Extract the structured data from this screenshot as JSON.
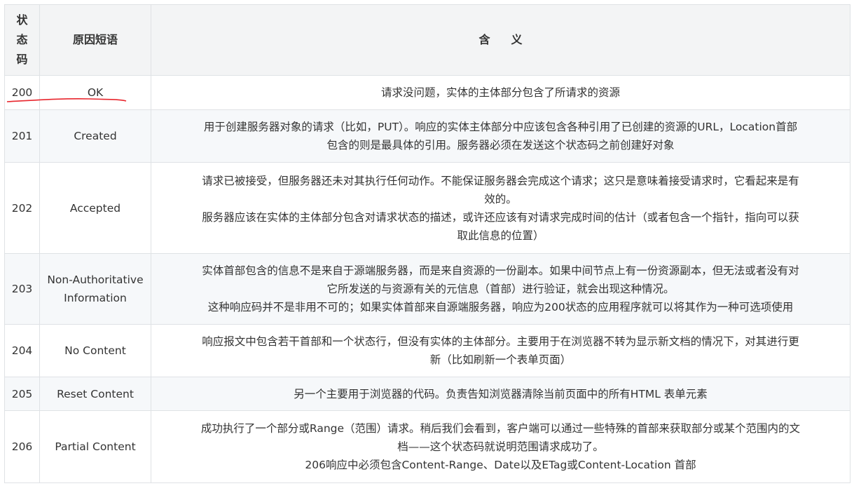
{
  "header": {
    "code_chars": [
      "状",
      "态",
      "码"
    ],
    "reason": "原因短语",
    "meaning": "含义"
  },
  "rows": [
    {
      "code": "200",
      "reason": [
        "OK"
      ],
      "meaning": [
        "请求没问题，实体的主体部分包含了所请求的资源"
      ]
    },
    {
      "code": "201",
      "reason": [
        "Created"
      ],
      "meaning": [
        "用于创建服务器对象的请求（比如，PUT）。响应的实体主体部分中应该包含各种引用了已创建的资源的URL，Location首部",
        "包含的则是最具体的引用。服务器必须在发送这个状态码之前创建好对象"
      ]
    },
    {
      "code": "202",
      "reason": [
        "Accepted"
      ],
      "meaning": [
        "请求已被接受，但服务器还未对其执行任何动作。不能保证服务器会完成这个请求；这只是意味着接受请求时，它看起来是有",
        "效的。",
        "服务器应该在实体的主体部分包含对请求状态的描述，或许还应该有对请求完成时间的估计（或者包含一个指针，指向可以获",
        "取此信息的位置）"
      ]
    },
    {
      "code": "203",
      "reason": [
        "Non-Authoritative",
        "Information"
      ],
      "meaning": [
        "实体首部包含的信息不是来自于源端服务器，而是来自资源的一份副本。如果中间节点上有一份资源副本，但无法或者没有对",
        "它所发送的与资源有关的元信息（首部）进行验证，就会出现这种情况。",
        "这种响应码并不是非用不可的；如果实体首部来自源端服务器，响应为200状态的应用程序就可以将其作为一种可选项使用"
      ]
    },
    {
      "code": "204",
      "reason": [
        "No Content"
      ],
      "meaning": [
        "响应报文中包含若干首部和一个状态行，但没有实体的主体部分。主要用于在浏览器不转为显示新文档的情况下，对其进行更",
        "新（比如刷新一个表单页面）"
      ]
    },
    {
      "code": "205",
      "reason": [
        "Reset Content"
      ],
      "meaning": [
        "另一个主要用于浏览器的代码。负责告知浏览器清除当前页面中的所有HTML 表单元素"
      ]
    },
    {
      "code": "206",
      "reason": [
        "Partial Content"
      ],
      "meaning": [
        "成功执行了一个部分或Range（范围）请求。稍后我们会看到，客户端可以通过一些特殊的首部来获取部分或某个范围内的文",
        "档——这个状态码就说明范围请求成功了。",
        "206响应中必须包含Content-Range、Date以及ETag或Content-Location 首部"
      ]
    }
  ],
  "colors": {
    "border": "#dfe2e5",
    "header_bg": "#f3f4f5",
    "stripe_bg": "#f6f8fa",
    "annotation": "#e8262d"
  }
}
